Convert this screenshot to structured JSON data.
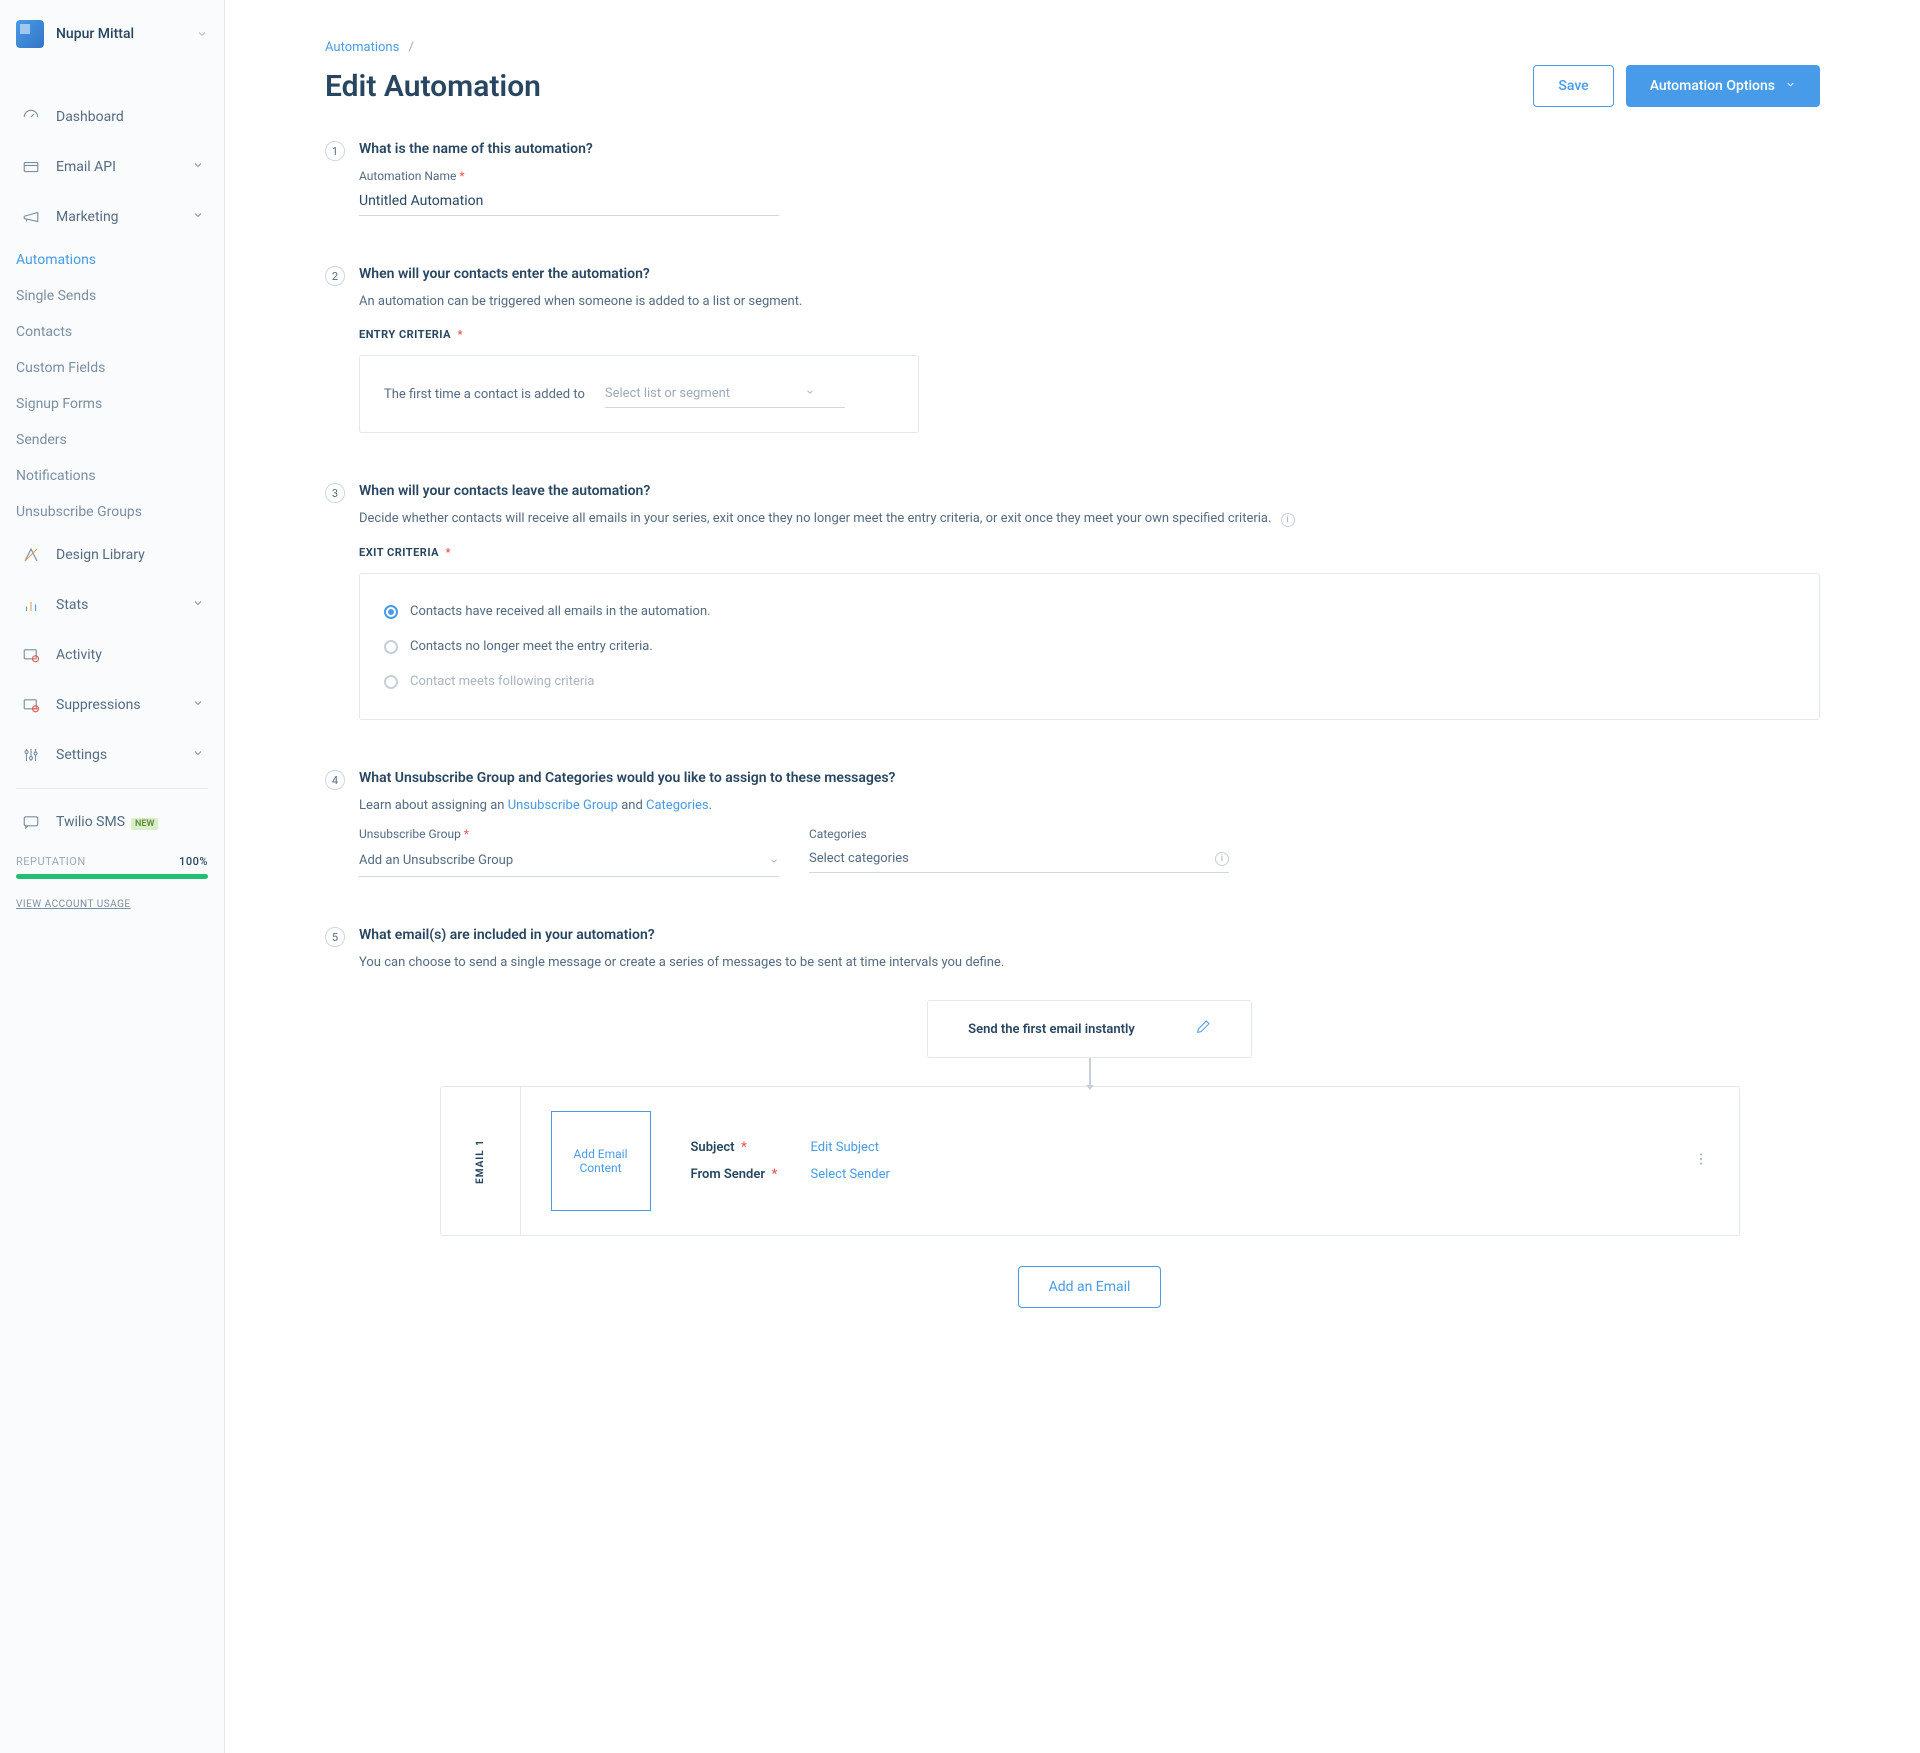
{
  "user": {
    "name": "Nupur Mittal"
  },
  "sidebar": {
    "dashboard": "Dashboard",
    "emailApi": "Email API",
    "marketing": "Marketing",
    "marketingSub": {
      "automations": "Automations",
      "singleSends": "Single Sends",
      "contacts": "Contacts",
      "customFields": "Custom Fields",
      "signupForms": "Signup Forms",
      "senders": "Senders",
      "notifications": "Notifications",
      "unsubscribeGroups": "Unsubscribe Groups"
    },
    "designLibrary": "Design Library",
    "stats": "Stats",
    "activity": "Activity",
    "suppressions": "Suppressions",
    "settings": "Settings",
    "twilioSms": "Twilio SMS",
    "twilioBadge": "NEW",
    "reputationLabel": "REPUTATION",
    "reputationValue": "100%",
    "viewUsage": "VIEW ACCOUNT USAGE"
  },
  "breadcrumb": {
    "root": "Automations"
  },
  "pageTitle": "Edit Automation",
  "actions": {
    "save": "Save",
    "options": "Automation Options"
  },
  "step1": {
    "title": "What is the name of this automation?",
    "label": "Automation Name",
    "value": "Untitled Automation"
  },
  "step2": {
    "title": "When will your contacts enter the automation?",
    "desc": "An automation can be triggered when someone is added to a list or segment.",
    "criteriaLabel": "ENTRY CRITERIA",
    "entryText": "The first time a contact is added to",
    "selectPlaceholder": "Select list or segment"
  },
  "step3": {
    "title": "When will your contacts leave the automation?",
    "desc": "Decide whether contacts will receive all emails in your series, exit once they no longer meet the entry criteria, or exit once they meet your own specified criteria.",
    "criteriaLabel": "EXIT CRITERIA",
    "option1": "Contacts have received all emails in the automation.",
    "option2": "Contacts no longer meet the entry criteria.",
    "option3": "Contact meets following criteria"
  },
  "step4": {
    "title": "What Unsubscribe Group and Categories would you like to assign to these messages?",
    "descPrefix": "Learn about assigning an ",
    "linkUnsub": "Unsubscribe Group",
    "descAnd": " and ",
    "linkCat": "Categories",
    "labelUnsub": "Unsubscribe Group",
    "placeholderUnsub": "Add an Unsubscribe Group",
    "labelCat": "Categories",
    "placeholderCat": "Select categories"
  },
  "step5": {
    "title": "What email(s) are included in your automation?",
    "desc": "You can choose to send a single message or create a series of messages to be sent at time intervals you define.",
    "sendInstant": "Send the first email instantly",
    "emailLabel": "EMAIL 1",
    "addContent": "Add Email Content",
    "subjectLabel": "Subject",
    "subjectAction": "Edit Subject",
    "senderLabel": "From Sender",
    "senderAction": "Select Sender",
    "addEmail": "Add an Email"
  }
}
